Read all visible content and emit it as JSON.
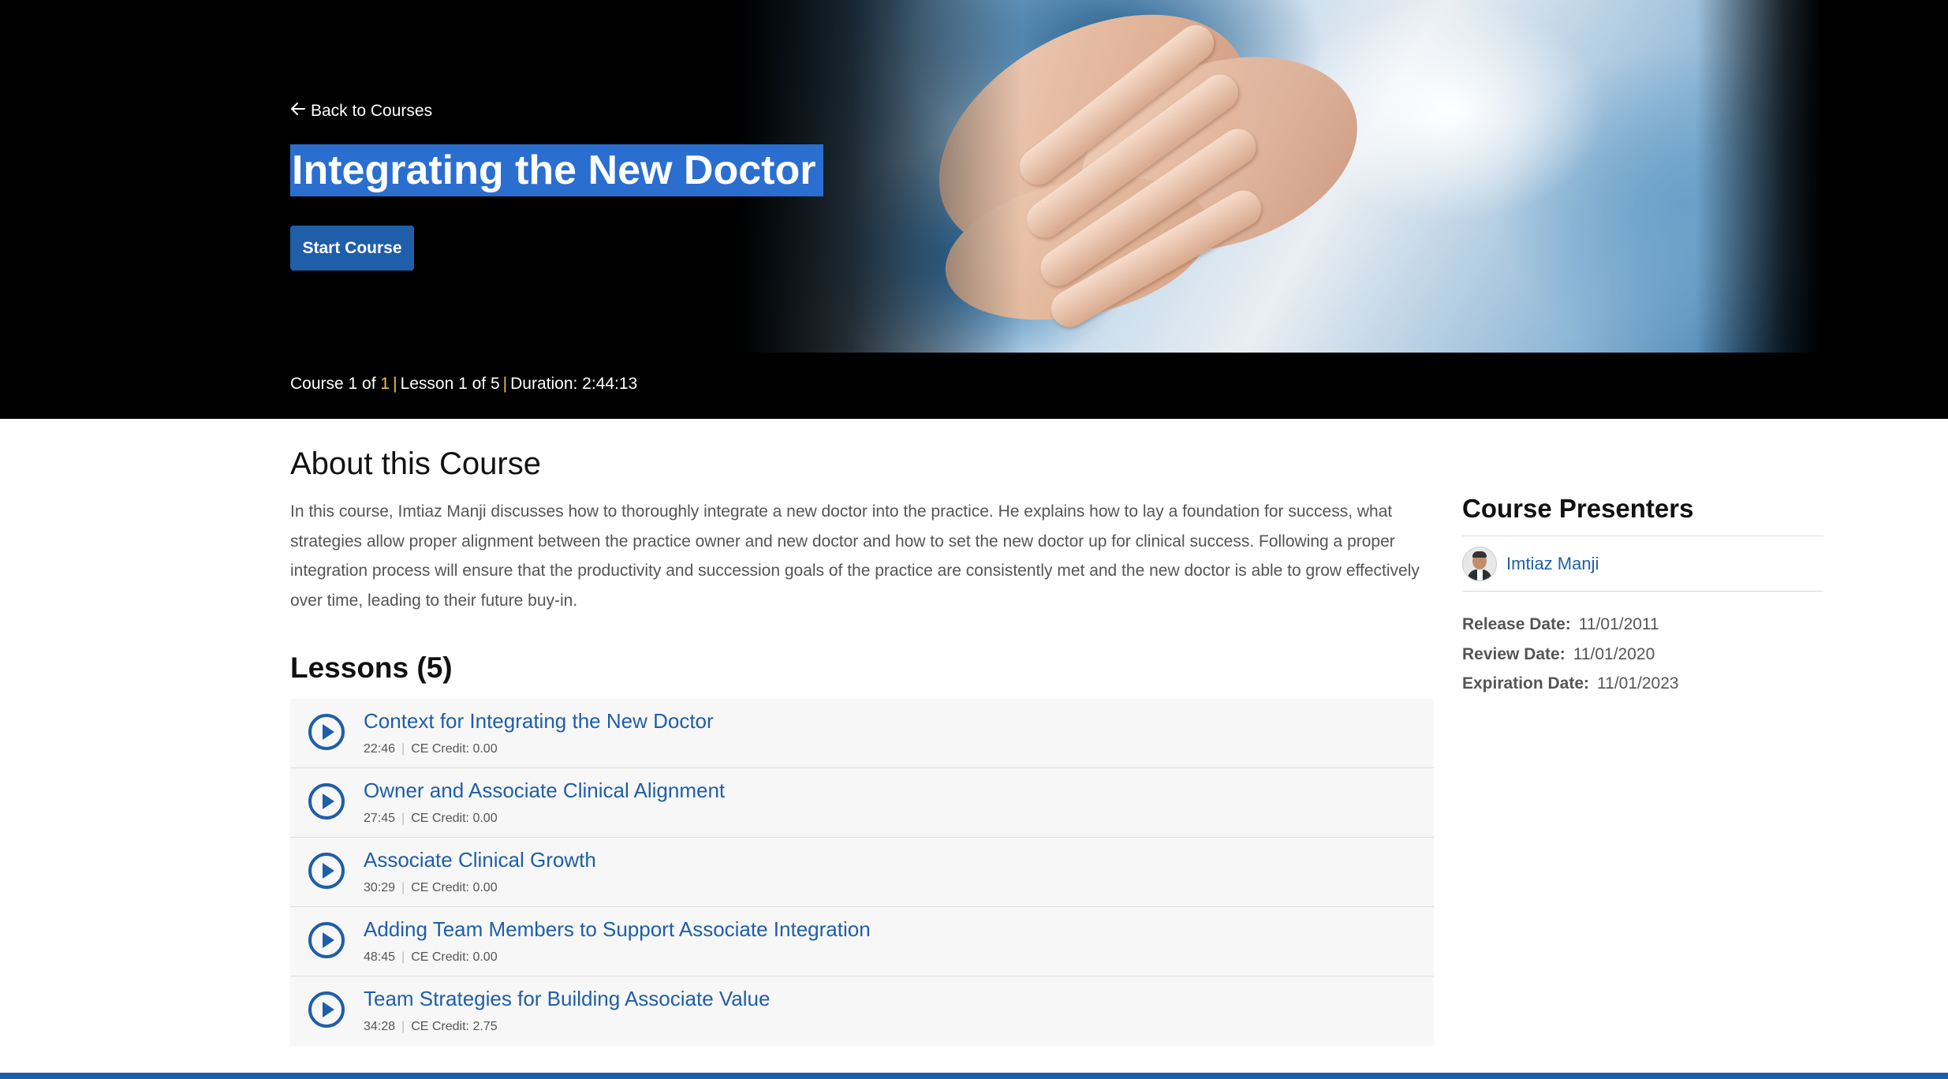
{
  "hero": {
    "back_label": "Back to Courses",
    "title": "Integrating the New Doctor",
    "start_label": "Start Course"
  },
  "meta": {
    "course_prefix": "Course 1 of",
    "course_total": "1",
    "lesson": "Lesson 1 of 5",
    "duration": "Duration: 2:44:13"
  },
  "about": {
    "heading": "About this Course",
    "text": "In this course, Imtiaz Manji discusses how to thoroughly integrate a new doctor into the practice. He explains how to lay a foundation for success, what strategies allow proper alignment between the practice owner and new doctor and how to set the new doctor up for clinical success. Following a proper integration process will ensure that the productivity and succession goals of the practice are consistently met and the new doctor is able to grow effectively over time, leading to their future buy-in."
  },
  "lessons": {
    "heading": "Lessons (5)",
    "items": [
      {
        "title": "Context for Integrating the New Doctor",
        "duration": "22:46",
        "credit": "CE Credit: 0.00"
      },
      {
        "title": "Owner and Associate Clinical Alignment",
        "duration": "27:45",
        "credit": "CE Credit: 0.00"
      },
      {
        "title": "Associate Clinical Growth",
        "duration": "30:29",
        "credit": "CE Credit: 0.00"
      },
      {
        "title": "Adding Team Members to Support Associate Integration",
        "duration": "48:45",
        "credit": "CE Credit: 0.00"
      },
      {
        "title": "Team Strategies for Building Associate Value",
        "duration": "34:28",
        "credit": "CE Credit: 2.75"
      }
    ]
  },
  "sidebar": {
    "heading": "Course Presenters",
    "presenter": "Imtiaz Manji",
    "release_label": "Release Date:",
    "release_value": "11/01/2011",
    "review_label": "Review Date:",
    "review_value": "11/01/2020",
    "expiration_label": "Expiration Date:",
    "expiration_value": "11/01/2023"
  },
  "colors": {
    "accent_blue": "#1f5ea8",
    "title_highlight": "#2a6ed0",
    "meta_separator": "#f5c242"
  },
  "icons": {
    "back": "arrow-left-icon",
    "lesson": "play-circle-icon"
  }
}
